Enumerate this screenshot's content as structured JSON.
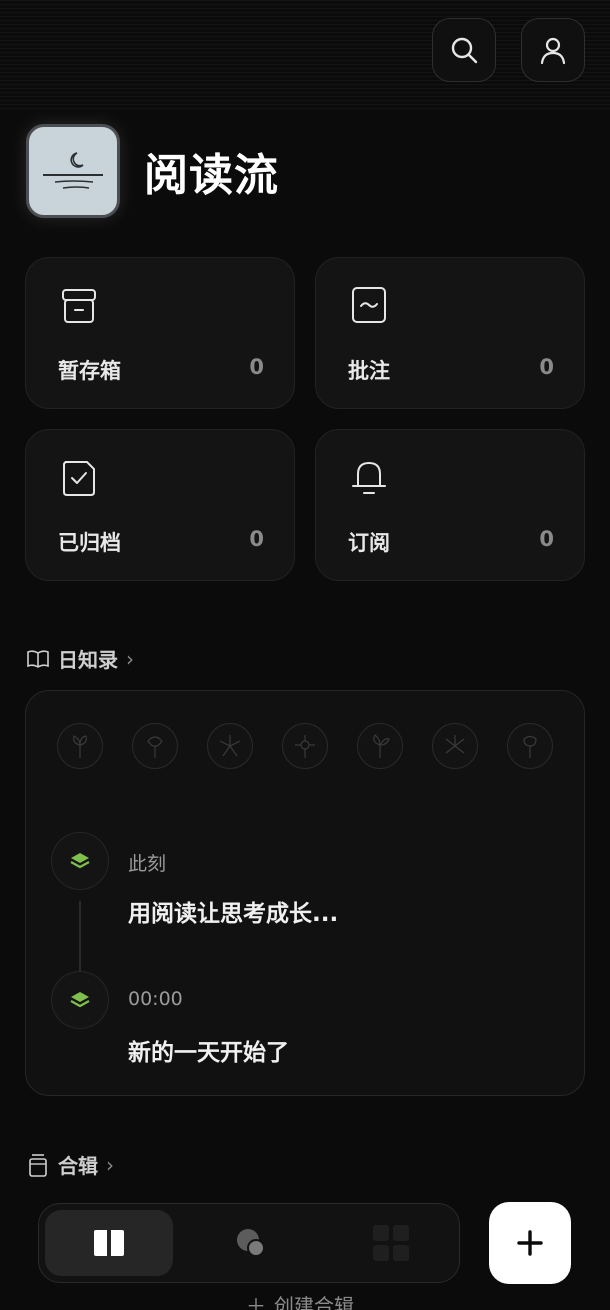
{
  "app": {
    "title": "阅读流"
  },
  "header_icons": {
    "search": "search-icon",
    "profile": "user-icon"
  },
  "cards": [
    {
      "label": "暂存箱",
      "count": "0",
      "icon": "inbox-icon"
    },
    {
      "label": "批注",
      "count": "0",
      "icon": "annotation-icon"
    },
    {
      "label": "已归档",
      "count": "0",
      "icon": "archive-check-icon"
    },
    {
      "label": "订阅",
      "count": "0",
      "icon": "bell-icon"
    }
  ],
  "journal_section": {
    "title": "日知录",
    "chevron": "›"
  },
  "journal": {
    "entries": [
      {
        "time": "此刻",
        "text": "用阅读让思考成长..."
      },
      {
        "time": "00:00",
        "text": "新的一天开始了"
      }
    ],
    "flowers": [
      "flower-1",
      "flower-2",
      "flower-3",
      "flower-4",
      "flower-5",
      "flower-6",
      "flower-7"
    ]
  },
  "collection_section": {
    "title": "合辑",
    "chevron": "›",
    "create_label": "创建合辑"
  },
  "bottom_nav": {
    "tabs": [
      "book-icon",
      "shapes-icon",
      "grid-icon"
    ],
    "fab": "+"
  },
  "colors": {
    "background": "#0b0b0b",
    "card": "#141414",
    "accent_green": "#7fbf4d"
  }
}
